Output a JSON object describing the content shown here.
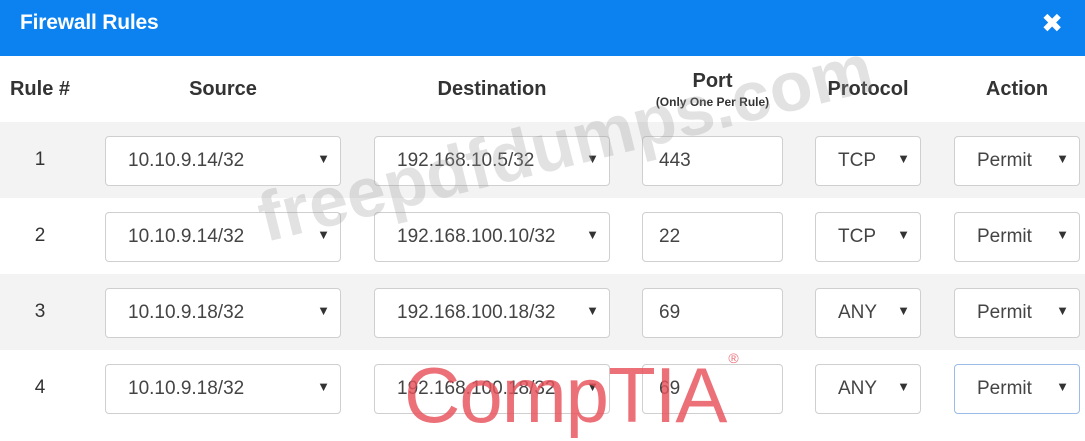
{
  "dialog": {
    "title": "Firewall Rules",
    "close_glyph": "✖"
  },
  "columns": {
    "rule": "Rule #",
    "source": "Source",
    "destination": "Destination",
    "port": "Port",
    "port_sub": "(Only One Per Rule)",
    "protocol": "Protocol",
    "action": "Action"
  },
  "rules": [
    {
      "num": "1",
      "source": "10.10.9.14/32",
      "destination": "192.168.10.5/32",
      "port": "443",
      "protocol": "TCP",
      "action": "Permit"
    },
    {
      "num": "2",
      "source": "10.10.9.14/32",
      "destination": "192.168.100.10/32",
      "port": "22",
      "protocol": "TCP",
      "action": "Permit"
    },
    {
      "num": "3",
      "source": "10.10.9.18/32",
      "destination": "192.168.100.18/32",
      "port": "69",
      "protocol": "ANY",
      "action": "Permit"
    },
    {
      "num": "4",
      "source": "10.10.9.18/32",
      "destination": "192.168.100.18/32",
      "port": "69",
      "protocol": "ANY",
      "action": "Permit"
    }
  ],
  "watermarks": {
    "site": "freepdfdumps.com",
    "brand": "CompTIA",
    "brand_mark": "®"
  },
  "colors": {
    "titlebar": "#0b82ef",
    "row_alt": "#f3f3f3"
  }
}
